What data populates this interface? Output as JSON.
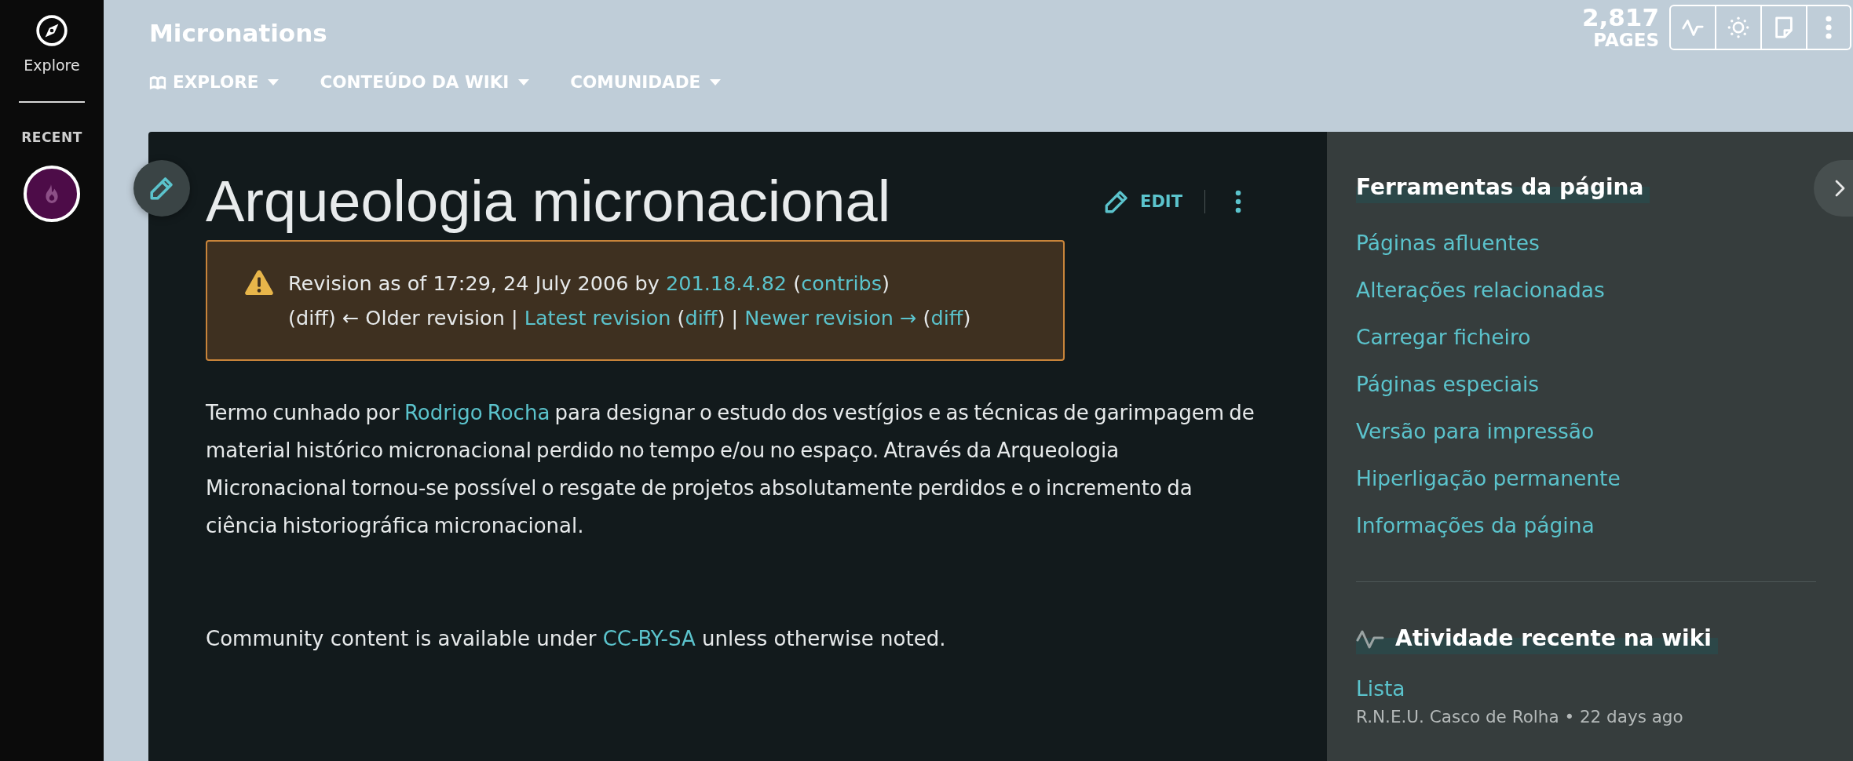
{
  "sidebar": {
    "explore_label": "Explore",
    "recent_label": "RECENT"
  },
  "header": {
    "wiki_name": "Micronations",
    "nav": [
      {
        "label": "EXPLORE",
        "kind": "with_icon"
      },
      {
        "label": "CONTEÚDO DA WIKI",
        "kind": "plain"
      },
      {
        "label": "COMUNIDADE",
        "kind": "plain"
      }
    ],
    "page_count": "2,817",
    "page_count_label": "PAGES"
  },
  "article": {
    "title": "Arqueologia micronacional",
    "edit_label": "EDIT",
    "revision_notice": [
      [
        {
          "kind": "text",
          "text": "Revision as of 17:29, 24 July 2006 by "
        },
        {
          "kind": "link",
          "text": "201.18.4.82"
        },
        {
          "kind": "text",
          "text": " ("
        },
        {
          "kind": "link",
          "text": "contribs"
        },
        {
          "kind": "text",
          "text": ")"
        }
      ],
      [
        {
          "kind": "text",
          "text": "(diff) ← Older revision | "
        },
        {
          "kind": "link",
          "text": "Latest revision"
        },
        {
          "kind": "text",
          "text": " ("
        },
        {
          "kind": "link",
          "text": "diff"
        },
        {
          "kind": "text",
          "text": ") | "
        },
        {
          "kind": "link",
          "text": "Newer revision →"
        },
        {
          "kind": "text",
          "text": " ("
        },
        {
          "kind": "link",
          "text": "diff"
        },
        {
          "kind": "text",
          "text": ")"
        }
      ]
    ],
    "paragraph": [
      {
        "kind": "text",
        "text": "Termo cunhado por "
      },
      {
        "kind": "link",
        "text": "Rodrigo Rocha"
      },
      {
        "kind": "text",
        "text": " para designar o estudo dos vestígios e as técnicas de garimpagem de material histórico micronacional perdido no tempo e/ou no espaço. Através da Arqueologia Micronacional tornou-se possível o resgate de projetos absolutamente perdidos e o incremento da ciência historiográfica micronacional."
      }
    ],
    "license": [
      {
        "kind": "text",
        "text": "Community content is available under "
      },
      {
        "kind": "link",
        "text": "CC-BY-SA"
      },
      {
        "kind": "text",
        "text": " unless otherwise noted."
      }
    ]
  },
  "page_tools": {
    "heading": "Ferramentas da página",
    "links": [
      "Páginas afluentes",
      "Alterações relacionadas",
      "Carregar ficheiro",
      "Páginas especiais",
      "Versão para impressão",
      "Hiperligação permanente",
      "Informações da página"
    ]
  },
  "recent_activity": {
    "heading": "Atividade recente na wiki",
    "items": [
      {
        "title": "Lista",
        "meta": "R.N.E.U. Casco de Rolha • 22 days ago"
      }
    ]
  }
}
